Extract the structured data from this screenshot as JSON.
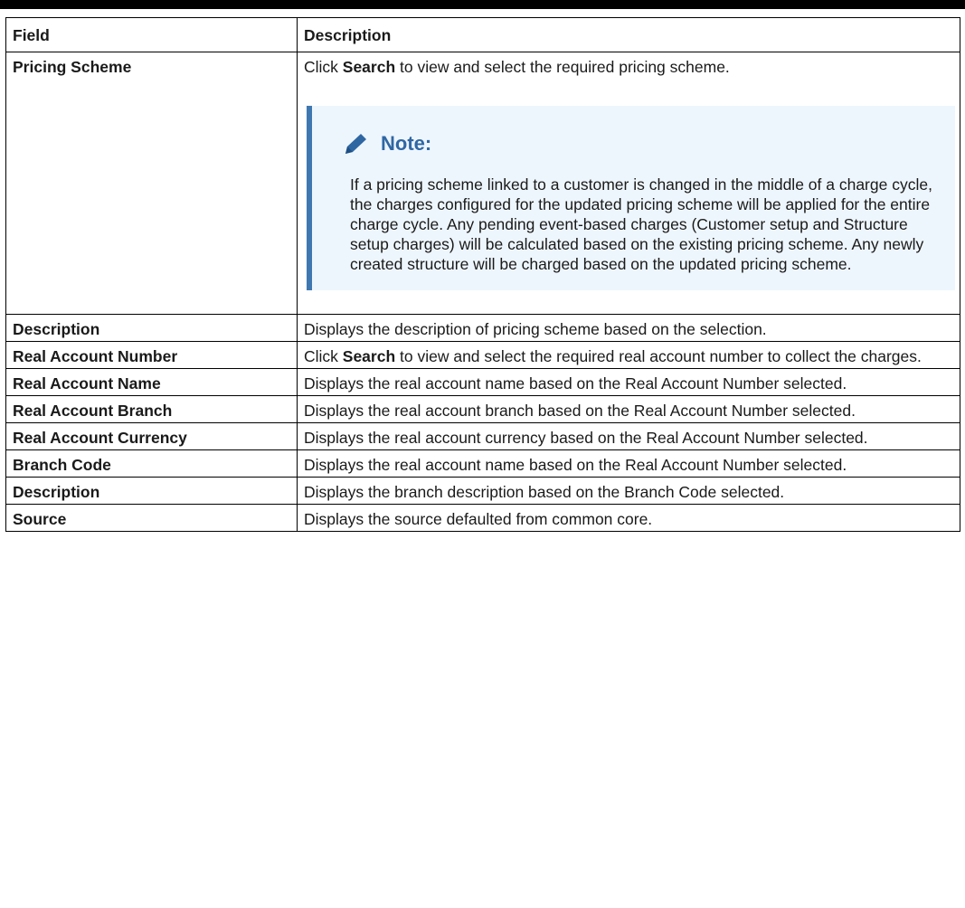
{
  "table": {
    "headers": {
      "field": "Field",
      "description": "Description"
    },
    "rows": [
      {
        "field": "Pricing Scheme",
        "desc_pre": "Click ",
        "desc_bold": "Search",
        "desc_post": " to view and select the required pricing scheme.",
        "note": {
          "title": "Note:",
          "icon": "pencil-icon",
          "text": "If a pricing scheme linked to a customer is changed in the middle of a charge cycle, the charges configured for the updated pricing scheme will be applied for the entire charge cycle. Any pending event-based charges (Customer setup and Structure setup charges) will be calculated based on the existing pricing scheme. Any newly created structure will be charged based on the updated pricing scheme."
        }
      },
      {
        "field": "Description",
        "desc": "Displays the description of pricing scheme based on the selection."
      },
      {
        "field": "Real Account Number",
        "desc_pre": "Click ",
        "desc_bold": "Search",
        "desc_post": " to view and select the required real account number to collect the charges."
      },
      {
        "field": "Real Account Name",
        "desc": "Displays the real account name based on the Real Account Number selected."
      },
      {
        "field": "Real Account Branch",
        "desc": "Displays the real account branch based on the Real Account Number selected."
      },
      {
        "field": "Real Account Currency",
        "desc": "Displays the real account currency based on the Real Account Number selected."
      },
      {
        "field": "Branch Code",
        "desc": "Displays the real account name based on the Real Account Number selected."
      },
      {
        "field": "Description",
        "desc": "Displays the branch description based on the Branch Code selected."
      },
      {
        "field": "Source",
        "desc": "Displays the source defaulted from common core."
      }
    ]
  },
  "colors": {
    "note_accent": "#3f78b0",
    "note_background": "#eef6fd",
    "note_title": "#2f67a3"
  }
}
